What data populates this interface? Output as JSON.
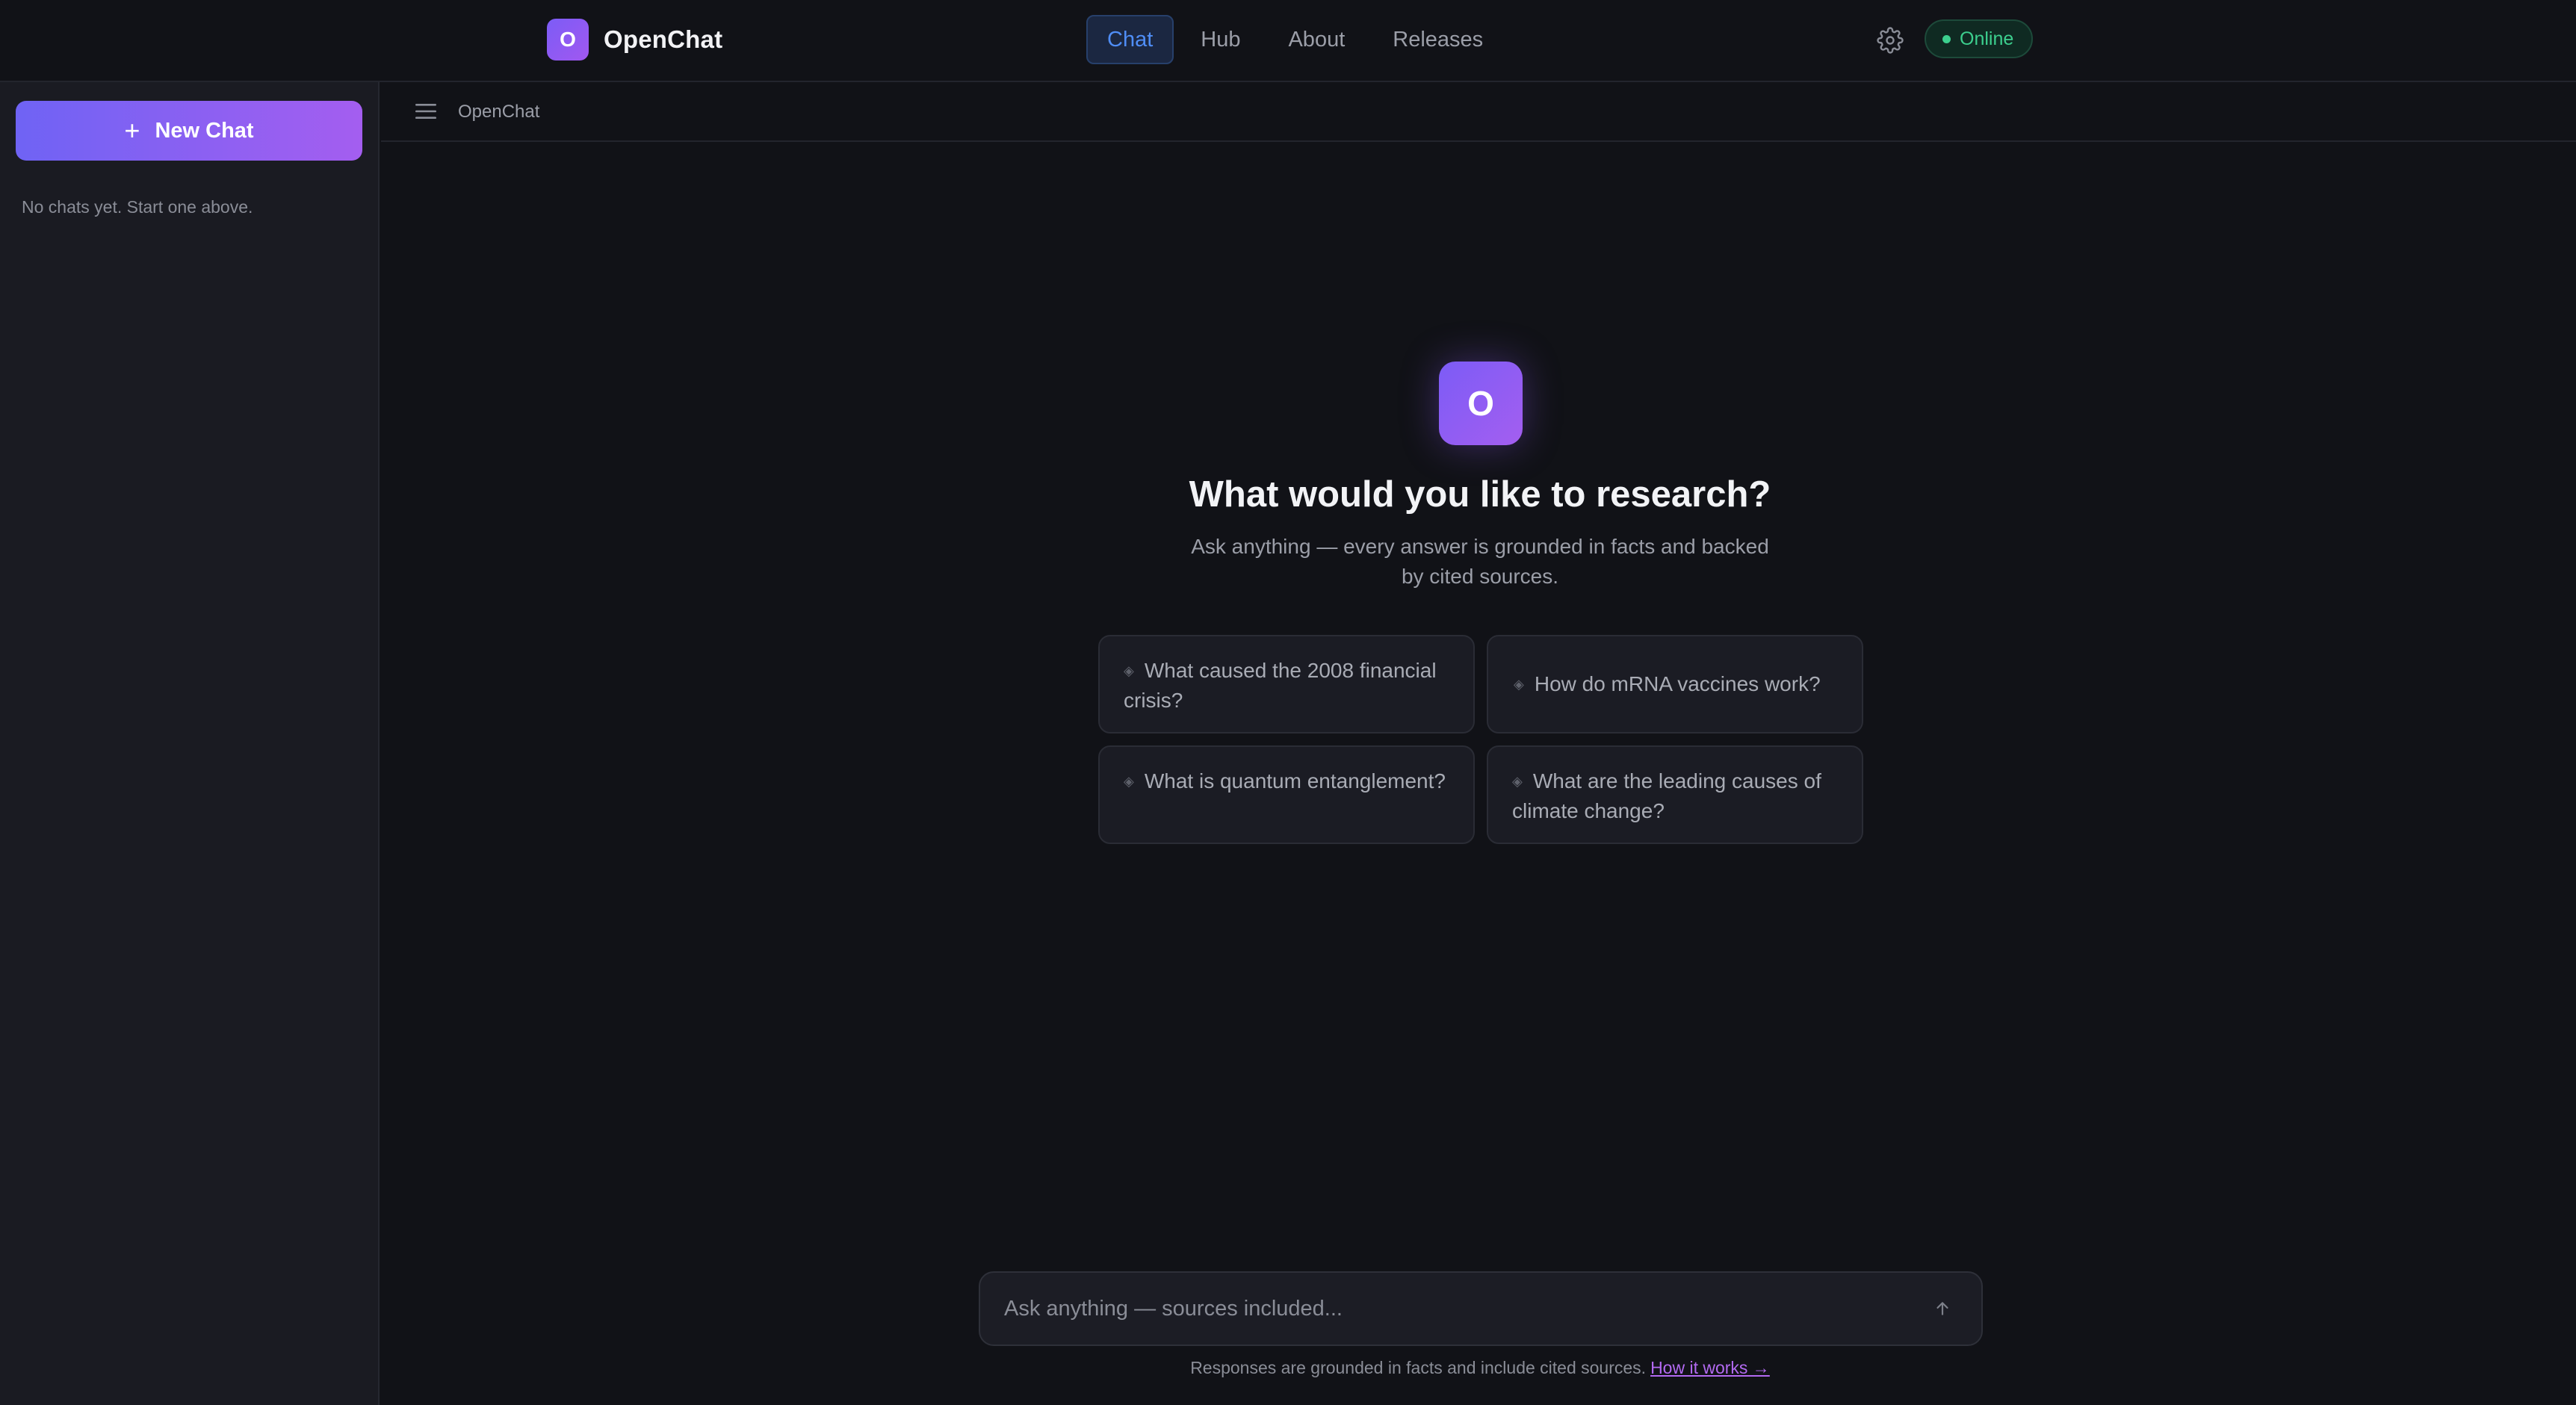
{
  "app": {
    "logo_letter": "O",
    "name": "OpenChat",
    "accent": "#8b5cf6"
  },
  "nav": {
    "items": [
      {
        "label": "Chat",
        "active": true
      },
      {
        "label": "Hub",
        "active": false
      },
      {
        "label": "About",
        "active": false
      },
      {
        "label": "Releases",
        "active": false
      }
    ]
  },
  "header": {
    "settings_icon": "gear-icon",
    "status_label": "Online",
    "status_color": "#3ccf8e"
  },
  "sidebar": {
    "new_chat_label": "New Chat",
    "empty_note": "No chats yet. Start one above."
  },
  "main": {
    "breadcrumb": "OpenChat",
    "hero_letter": "O",
    "title": "What would you like to research?",
    "subtitle": "Ask anything — every answer is grounded in facts and backed by cited sources.",
    "suggestions": [
      "What caused the 2008 financial crisis?",
      "How do mRNA vaccines work?",
      "What is quantum entanglement?",
      "What are the leading causes of climate change?"
    ]
  },
  "composer": {
    "placeholder": "Ask anything — sources included...",
    "value": ""
  },
  "footer": {
    "disclaimer": "Responses are grounded in facts and include cited sources.",
    "link_label": "How it works →"
  }
}
